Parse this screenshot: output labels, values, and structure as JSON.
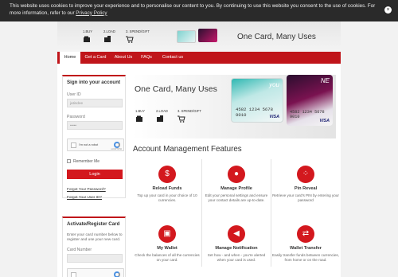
{
  "cookie": {
    "text": "This website uses cookies to improve your experience and to personalise our content to you. By continuing to use this website you consent to the use of cookies. For more information, refer to our ",
    "link": "Privacy Policy",
    "close": "×"
  },
  "header": {
    "tagline": "One Card, Many Uses",
    "steps": [
      "1.BUY",
      "2.LOAD",
      "3. SPEND/GIFT"
    ]
  },
  "nav": {
    "items": [
      "Home",
      "Get a Card",
      "About Us",
      "FAQs",
      "Contact us"
    ]
  },
  "login": {
    "title": "Sign into your account",
    "user_label": "User ID",
    "user_value": "jatindee",
    "password_label": "Password",
    "password_value": "•••••",
    "captcha_text": "I'm not a robot",
    "captcha_brand": "reCAPTCHA",
    "remember": "Remember Me",
    "button": "Login",
    "forgot_password": "Forgot Your Password?",
    "forgot_user": "Forgot Your User ID?"
  },
  "register": {
    "title": "Activate/Register Card",
    "description": "Enter your card number below to register and use your new card.",
    "card_label": "Card Number"
  },
  "banner": {
    "tagline": "One Card, Many Uses",
    "steps": [
      "1.BUY",
      "2.LOAD",
      "3. SPEND/GIFT"
    ],
    "card1": {
      "number": "4582 1234 5678 9010",
      "logo": "you",
      "brand": "VISA"
    },
    "card2": {
      "number": "4582 1234 5678 9010",
      "logo": "NE",
      "brand": "VISA"
    }
  },
  "features_title": "Account Management Features",
  "features": [
    {
      "icon": "currency-icon",
      "glyph": "$",
      "title": "Reload Funds",
      "desc": "Top up your card in your choice of 10 currencies."
    },
    {
      "icon": "user-icon",
      "glyph": "●",
      "title": "Manage Profile",
      "desc": "Edit your personal settings and ensure your contact details are up-to-date."
    },
    {
      "icon": "keypad-icon",
      "glyph": "⁘",
      "title": "Pin Reveal",
      "desc": "Retrieve your card's PIN by entering your password"
    },
    {
      "icon": "wallet-icon",
      "glyph": "▣",
      "title": "My Wallet",
      "desc": "Check the balances of all the currencies on your card."
    },
    {
      "icon": "megaphone-icon",
      "glyph": "◀",
      "title": "Manage Notification",
      "desc": "Set how - and when - you're alerted when your card is used."
    },
    {
      "icon": "transfer-icon",
      "glyph": "⇄",
      "title": "Wallet Transfer",
      "desc": "Easily transfer funds between currencies, from home or on the road."
    }
  ],
  "colors": {
    "accent": "#c0151a",
    "button": "#d3181e"
  }
}
